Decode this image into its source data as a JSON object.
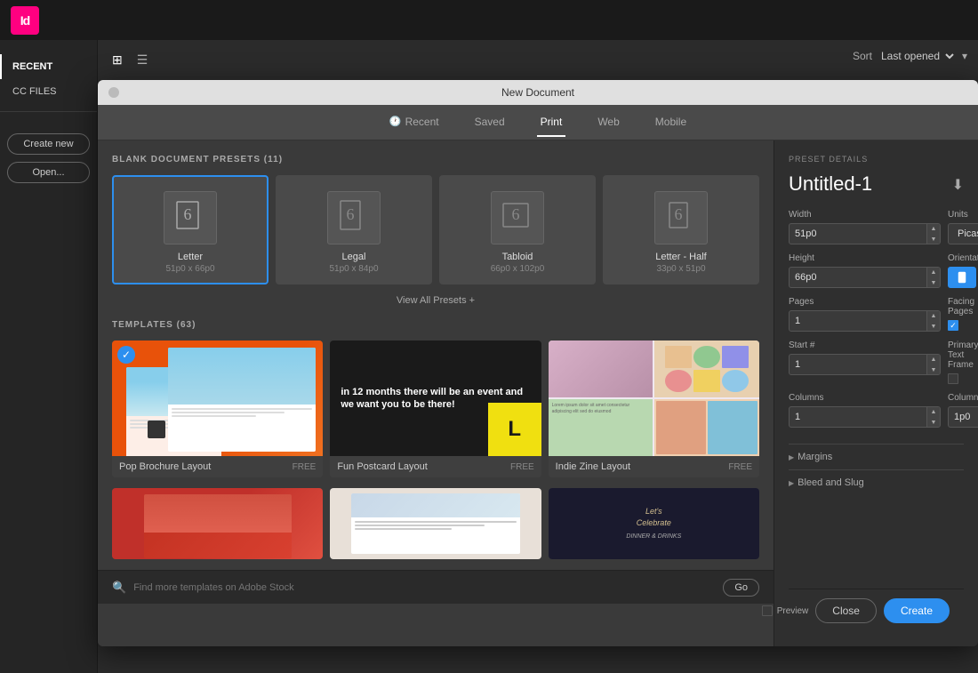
{
  "app": {
    "title": "Id",
    "bg_color": "#ff0080"
  },
  "sidebar": {
    "items": [
      {
        "label": "RECENT",
        "active": true
      },
      {
        "label": "CC FILES",
        "active": false
      }
    ],
    "buttons": [
      {
        "label": "Create new"
      },
      {
        "label": "Open..."
      }
    ]
  },
  "view_toolbar": {
    "grid_icon": "⊞",
    "list_icon": "☰"
  },
  "sort_bar": {
    "label": "Sort",
    "value": "Last opened",
    "arrow": "▾"
  },
  "dialog": {
    "title": "New Document",
    "tabs": [
      {
        "label": "Recent",
        "icon": "🕐",
        "active": false
      },
      {
        "label": "Saved",
        "active": false
      },
      {
        "label": "Print",
        "active": true
      },
      {
        "label": "Web",
        "active": false
      },
      {
        "label": "Mobile",
        "active": false
      }
    ],
    "blank_presets": {
      "header": "BLANK DOCUMENT PRESETS",
      "count": "(11)",
      "items": [
        {
          "name": "Letter",
          "dims": "51p0 x 66p0",
          "selected": true
        },
        {
          "name": "Legal",
          "dims": "51p0 x 84p0",
          "selected": false
        },
        {
          "name": "Tabloid",
          "dims": "66p0 x 102p0",
          "selected": false
        },
        {
          "name": "Letter - Half",
          "dims": "33p0 x 51p0",
          "selected": false
        }
      ],
      "view_all": "View All Presets +"
    },
    "templates": {
      "header": "TEMPLATES",
      "count": "(63)",
      "items": [
        {
          "name": "Pop Brochure Layout",
          "badge": "FREE",
          "selected": true
        },
        {
          "name": "Fun Postcard Layout",
          "badge": "FREE",
          "selected": false
        },
        {
          "name": "Indie Zine Layout",
          "badge": "FREE",
          "selected": false
        }
      ],
      "row2": [
        {
          "name": "",
          "badge": ""
        },
        {
          "name": "",
          "badge": ""
        },
        {
          "name": "",
          "badge": ""
        }
      ]
    },
    "search": {
      "placeholder": "Find more templates on Adobe Stock",
      "button": "Go"
    }
  },
  "preset_panel": {
    "section_label": "PRESET DETAILS",
    "name": "Untitled-1",
    "download_icon": "⬇",
    "width_label": "Width",
    "width_value": "51p0",
    "units_label": "Units",
    "units_value": "Picas",
    "height_label": "Height",
    "height_value": "66p0",
    "orientation_label": "Orientation",
    "pages_label": "Pages",
    "pages_value": "1",
    "facing_pages_label": "Facing Pages",
    "facing_pages_checked": true,
    "start_label": "Start #",
    "start_value": "1",
    "primary_text_label": "Primary Text Frame",
    "primary_text_checked": false,
    "columns_label": "Columns",
    "columns_value": "1",
    "gutter_label": "Column Gutter",
    "gutter_value": "1p0",
    "margins_label": "Margins",
    "bleed_label": "Bleed and Slug",
    "footer": {
      "preview_label": "Preview",
      "close_label": "Close",
      "create_label": "Create"
    }
  }
}
